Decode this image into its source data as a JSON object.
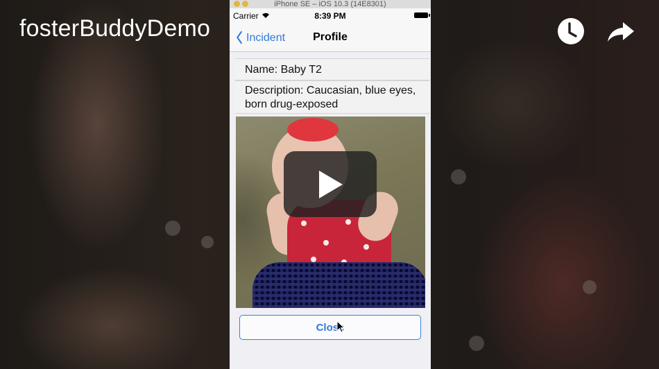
{
  "video": {
    "title": "fosterBuddyDemo"
  },
  "simulator": {
    "window_title": "iPhone SE – iOS 10.3 (14E8301)"
  },
  "status_bar": {
    "carrier": "Carrier",
    "time": "8:39 PM"
  },
  "nav": {
    "back_label": "Incident",
    "title": "Profile"
  },
  "profile": {
    "name": "Name: Baby T2",
    "description_line1": "Description: Caucasian, blue eyes,",
    "description_line2": "born drug-exposed"
  },
  "actions": {
    "close_label": "Close"
  },
  "icons": [
    "watch-later-icon",
    "share-icon",
    "play-icon",
    "back-chevron-icon",
    "wifi-icon",
    "battery-icon",
    "pointer-cursor-icon"
  ],
  "colors": {
    "ios_blue": "#2f7ad6",
    "play_button": "#212121"
  }
}
